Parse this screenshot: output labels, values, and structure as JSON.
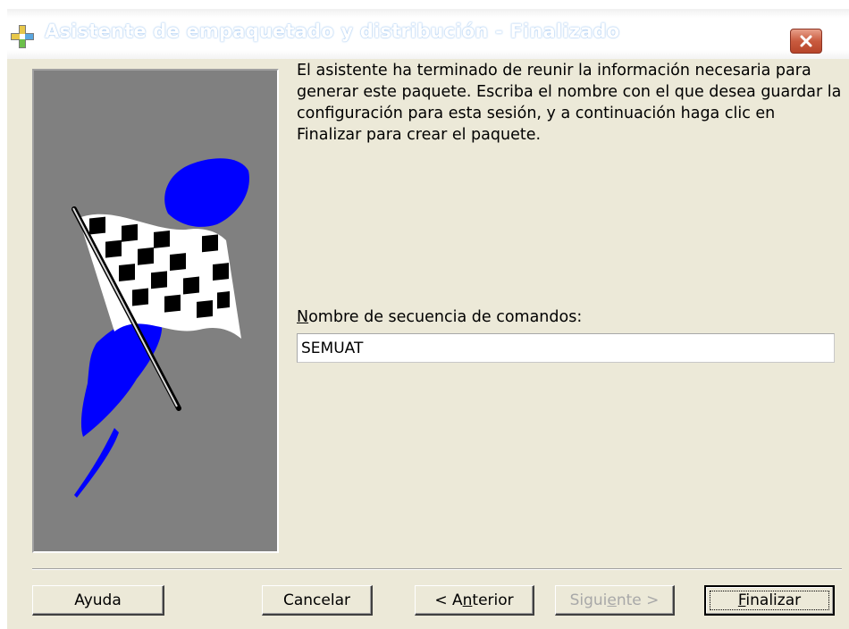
{
  "window": {
    "title": "Asistente de empaquetado y distribución - Finalizado",
    "title_icon": "package-wizard-icon",
    "close_icon": "close-icon"
  },
  "illustration": {
    "icon": "checkered-flag-icon"
  },
  "main": {
    "intro_text": "El asistente ha terminado de reunir la información necesaria para generar este paquete. Escriba el nombre con el que desea guardar la configuración para esta sesión, y a continuación haga clic en Finalizar para crear el paquete.",
    "script_label_accel": "N",
    "script_label_rest": "ombre de secuencia de comandos:",
    "script_name_value": "SEMUAT"
  },
  "buttons": {
    "help": "Ayuda",
    "cancel": "Cancelar",
    "back_pre": "< A",
    "back_accel": "n",
    "back_post": "terior",
    "next_pre": "Sigui",
    "next_accel": "e",
    "next_post": "nte >",
    "finish_accel": "F",
    "finish_rest": "inalizar"
  }
}
